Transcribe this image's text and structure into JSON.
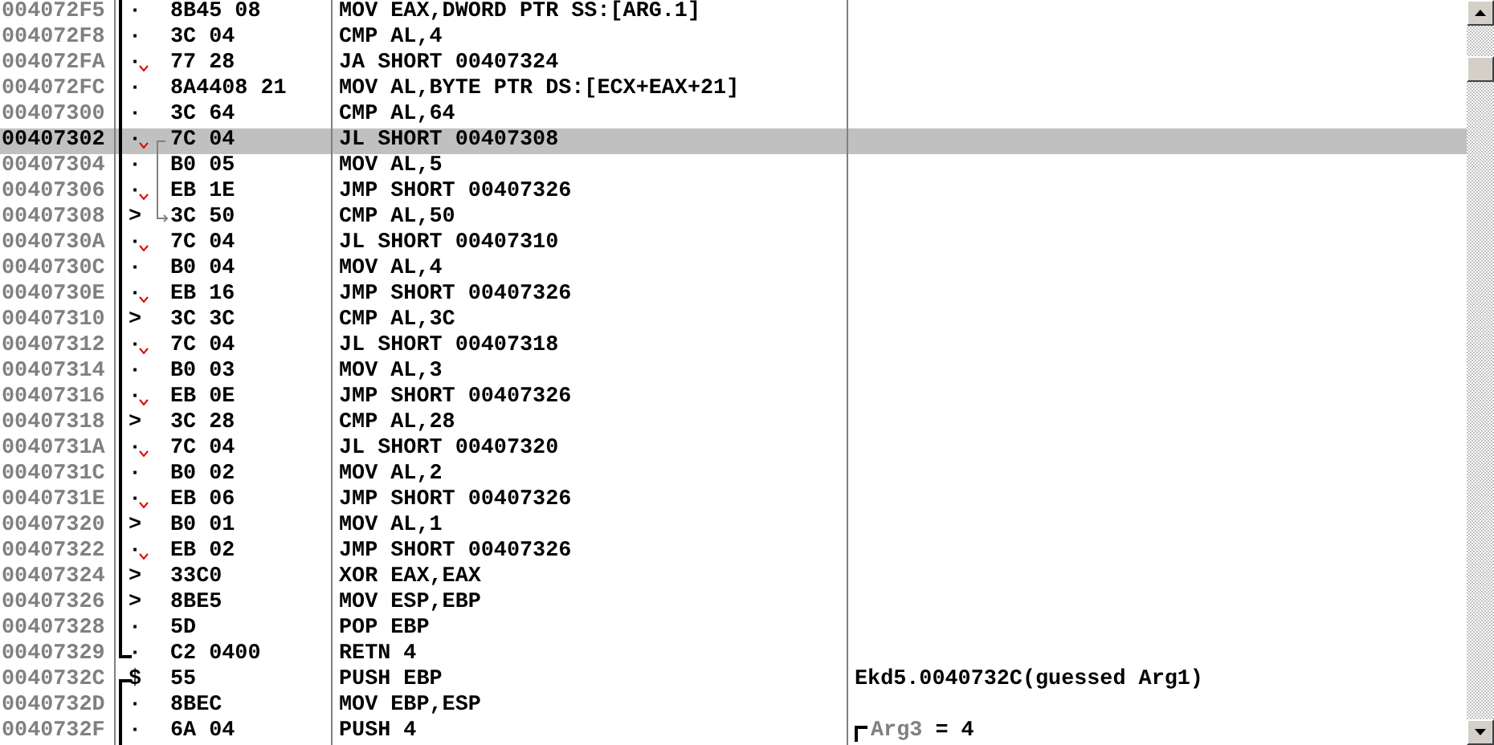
{
  "rows": [
    {
      "address": "004072F5",
      "marker": "·",
      "jump": false,
      "hex": "8B45 08",
      "disasm": "MOV EAX,DWORD PTR SS:[ARG.1]",
      "selected": false
    },
    {
      "address": "004072F8",
      "marker": "·",
      "jump": false,
      "hex": "3C 04",
      "disasm": "CMP AL,4",
      "selected": false
    },
    {
      "address": "004072FA",
      "marker": "·",
      "jump": true,
      "hex": "77 28",
      "disasm": "JA SHORT 00407324",
      "selected": false
    },
    {
      "address": "004072FC",
      "marker": "·",
      "jump": false,
      "hex": "8A4408 21",
      "disasm": "MOV AL,BYTE PTR DS:[ECX+EAX+21]",
      "selected": false
    },
    {
      "address": "00407300",
      "marker": "·",
      "jump": false,
      "hex": "3C 64",
      "disasm": "CMP AL,64",
      "selected": false
    },
    {
      "address": "00407302",
      "marker": "·",
      "jump": true,
      "arrow_from": true,
      "hex": "7C 04",
      "disasm": "JL SHORT 00407308",
      "selected": true
    },
    {
      "address": "00407304",
      "marker": "·",
      "jump": false,
      "arrow_through": true,
      "hex": "B0 05",
      "disasm": "MOV AL,5",
      "selected": false
    },
    {
      "address": "00407306",
      "marker": "·",
      "jump": true,
      "arrow_through": true,
      "hex": "EB 1E",
      "disasm": "JMP SHORT 00407326",
      "selected": false
    },
    {
      "address": "00407308",
      "marker": ">",
      "jump": false,
      "arrow_to": true,
      "hex": "3C 50",
      "disasm": "CMP AL,50",
      "selected": false
    },
    {
      "address": "0040730A",
      "marker": "·",
      "jump": true,
      "hex": "7C 04",
      "disasm": "JL SHORT 00407310",
      "selected": false
    },
    {
      "address": "0040730C",
      "marker": "·",
      "jump": false,
      "hex": "B0 04",
      "disasm": "MOV AL,4",
      "selected": false
    },
    {
      "address": "0040730E",
      "marker": "·",
      "jump": true,
      "hex": "EB 16",
      "disasm": "JMP SHORT 00407326",
      "selected": false
    },
    {
      "address": "00407310",
      "marker": ">",
      "jump": false,
      "hex": "3C 3C",
      "disasm": "CMP AL,3C",
      "selected": false
    },
    {
      "address": "00407312",
      "marker": "·",
      "jump": true,
      "hex": "7C 04",
      "disasm": "JL SHORT 00407318",
      "selected": false
    },
    {
      "address": "00407314",
      "marker": "·",
      "jump": false,
      "hex": "B0 03",
      "disasm": "MOV AL,3",
      "selected": false
    },
    {
      "address": "00407316",
      "marker": "·",
      "jump": true,
      "hex": "EB 0E",
      "disasm": "JMP SHORT 00407326",
      "selected": false
    },
    {
      "address": "00407318",
      "marker": ">",
      "jump": false,
      "hex": "3C 28",
      "disasm": "CMP AL,28",
      "selected": false
    },
    {
      "address": "0040731A",
      "marker": "·",
      "jump": true,
      "hex": "7C 04",
      "disasm": "JL SHORT 00407320",
      "selected": false
    },
    {
      "address": "0040731C",
      "marker": "·",
      "jump": false,
      "hex": "B0 02",
      "disasm": "MOV AL,2",
      "selected": false
    },
    {
      "address": "0040731E",
      "marker": "·",
      "jump": true,
      "hex": "EB 06",
      "disasm": "JMP SHORT 00407326",
      "selected": false
    },
    {
      "address": "00407320",
      "marker": ">",
      "jump": false,
      "hex": "B0 01",
      "disasm": "MOV AL,1",
      "selected": false
    },
    {
      "address": "00407322",
      "marker": "·",
      "jump": true,
      "hex": "EB 02",
      "disasm": "JMP SHORT 00407326",
      "selected": false
    },
    {
      "address": "00407324",
      "marker": ">",
      "jump": false,
      "hex": "33C0",
      "disasm": "XOR EAX,EAX",
      "selected": false
    },
    {
      "address": "00407326",
      "marker": ">",
      "jump": false,
      "hex": "8BE5",
      "disasm": "MOV ESP,EBP",
      "selected": false
    },
    {
      "address": "00407328",
      "marker": "·",
      "jump": false,
      "hex": "5D",
      "disasm": "POP EBP",
      "selected": false
    },
    {
      "address": "00407329",
      "marker": "·",
      "jump": false,
      "bracket_end": true,
      "hex": "C2 0400",
      "disasm": "RETN 4",
      "selected": false
    },
    {
      "address": "0040732C",
      "marker": "$",
      "jump": false,
      "bracket_start": true,
      "hex": "55",
      "disasm": "PUSH EBP",
      "comment": "Ekd5.0040732C(guessed Arg1)",
      "selected": false
    },
    {
      "address": "0040732D",
      "marker": "·",
      "jump": false,
      "hex": "8BEC",
      "disasm": "MOV EBP,ESP",
      "selected": false
    },
    {
      "address": "0040732F",
      "marker": "·",
      "jump": false,
      "hex": "6A 04",
      "disasm": "PUSH 4",
      "comment_label": "Arg3",
      "comment": "= 4",
      "comment_bracket": true,
      "selected": false
    }
  ]
}
